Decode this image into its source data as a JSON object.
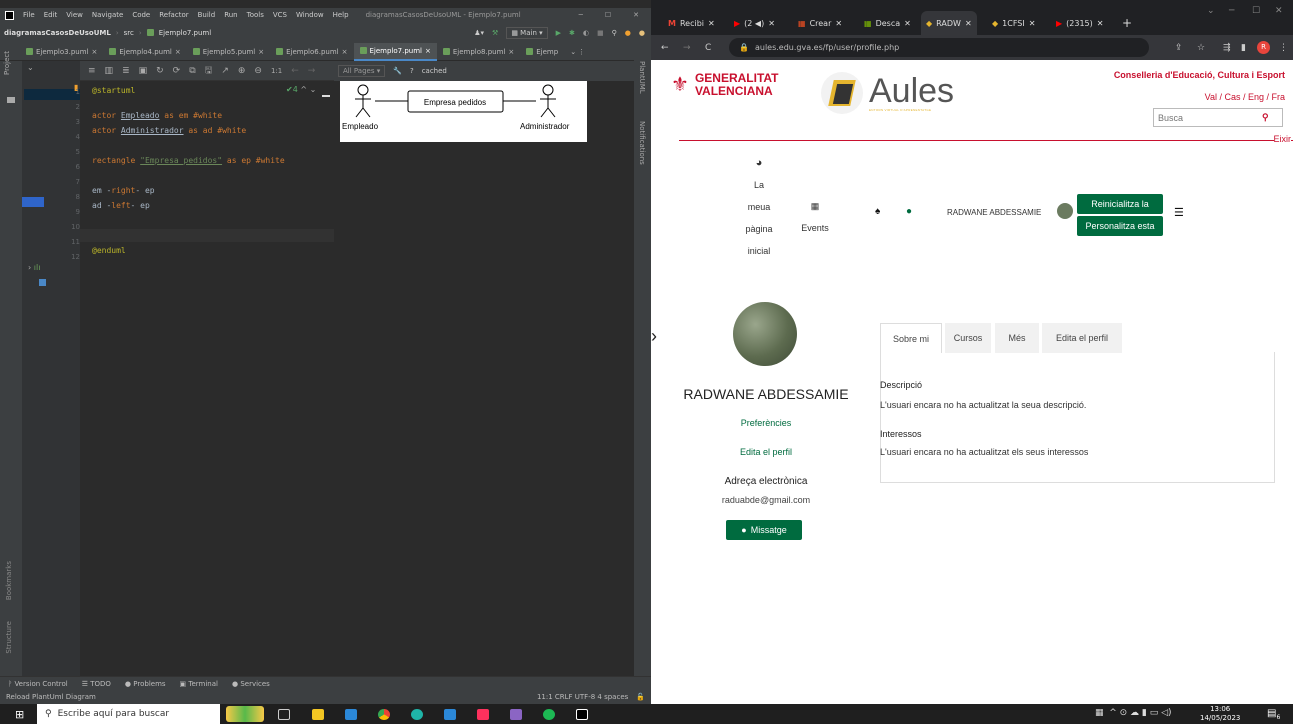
{
  "ide": {
    "menu": [
      "File",
      "Edit",
      "View",
      "Navigate",
      "Code",
      "Refactor",
      "Build",
      "Run",
      "Tools",
      "VCS",
      "Window",
      "Help"
    ],
    "window_title": "diagramasCasosDeUsoUML - Ejemplo7.puml",
    "project_name": "diagramasCasosDeUsoUML",
    "breadcrumb_src": "src",
    "breadcrumb_file": "Ejemplo7.puml",
    "run_config": "Main",
    "tabs": [
      "Ejemplo3.puml",
      "Ejemplo4.puml",
      "Ejemplo5.puml",
      "Ejemplo6.puml",
      "Ejemplo7.puml",
      "Ejemplo8.puml",
      "Ejemp"
    ],
    "preview_page": "All Pages",
    "preview_status": "cached",
    "warn_count": "4",
    "side_left": "Project",
    "side_bookmarks": "Bookmarks",
    "side_structure": "Structure",
    "side_right_1": "PlantUML",
    "side_right_2": "Notifications",
    "line_numbers": [
      "1",
      "2",
      "3",
      "4",
      "5",
      "6",
      "7",
      "8",
      "9",
      "10",
      "11",
      "12"
    ],
    "code": {
      "l1": "@startuml",
      "l3_a": "actor ",
      "l3_b": "Empleado",
      "l3_c": " as em #white",
      "l4_a": "actor ",
      "l4_b": "Administrador",
      "l4_c": " as ad #white",
      "l6_a": "rectangle ",
      "l6_b": "\"Empresa pedidos\"",
      "l6_c": " as ep #white",
      "l8_a": "em -",
      "l8_b": "right",
      "l8_c": "- ep",
      "l9_a": "ad -",
      "l9_b": "left",
      "l9_c": "- ep",
      "l12": "@enduml"
    },
    "diagram": {
      "actor1": "Empleado",
      "actor2": "Administrador",
      "box": "Empresa pedidos"
    },
    "status_tools": [
      "Version Control",
      "TODO",
      "Problems",
      "Terminal",
      "Services"
    ],
    "status_msg": "Reload PlantUml Diagram",
    "status_right": "11:1  CRLF  UTF-8  4 spaces"
  },
  "browser": {
    "tabs": [
      "Recibi",
      "(2 ◀)",
      "Crear",
      "Desca",
      "RADW",
      "1CFSI",
      "(2315)"
    ],
    "url": "aules.edu.gva.es/fp/user/profile.php",
    "page": {
      "gva": [
        "GENERALITAT",
        "VALENCIANA"
      ],
      "logo": "Aules",
      "logo_sub": "ENTORN VIRTUAL D'APRENENTATGE",
      "conselleria": "Conselleria d'Educació, Cultura i Esport",
      "langs": "Val / Cas / Eng / Fra",
      "search_placeholder": "Busca",
      "exit": "Eixir",
      "nav_home": [
        "La",
        "meua",
        "pàgina",
        "inicial"
      ],
      "nav_events": "Events",
      "user": "RADWANE ABDESSAMIE",
      "btn_reset": "Reinicialitza la",
      "btn_custom": "Personalitza esta",
      "profile_name": "RADWANE ABDESSAMIE",
      "prefs": "Preferències",
      "edit": "Edita el perfil",
      "email_label": "Adreça electrònica",
      "email": "raduabde@gmail.com",
      "message": "Missatge",
      "tabs": [
        "Sobre mi",
        "Cursos",
        "Més",
        "Edita el perfil"
      ],
      "desc_title": "Descripció",
      "desc_text": "L'usuari encara no ha actualitzat la seua descripció.",
      "int_title": "Interessos",
      "int_text": "L'usuari encara no ha actualitzat els seus interessos"
    }
  },
  "taskbar": {
    "search": "Escribe aquí para buscar",
    "time": "13:06",
    "date": "14/05/2023",
    "notif": "6"
  }
}
